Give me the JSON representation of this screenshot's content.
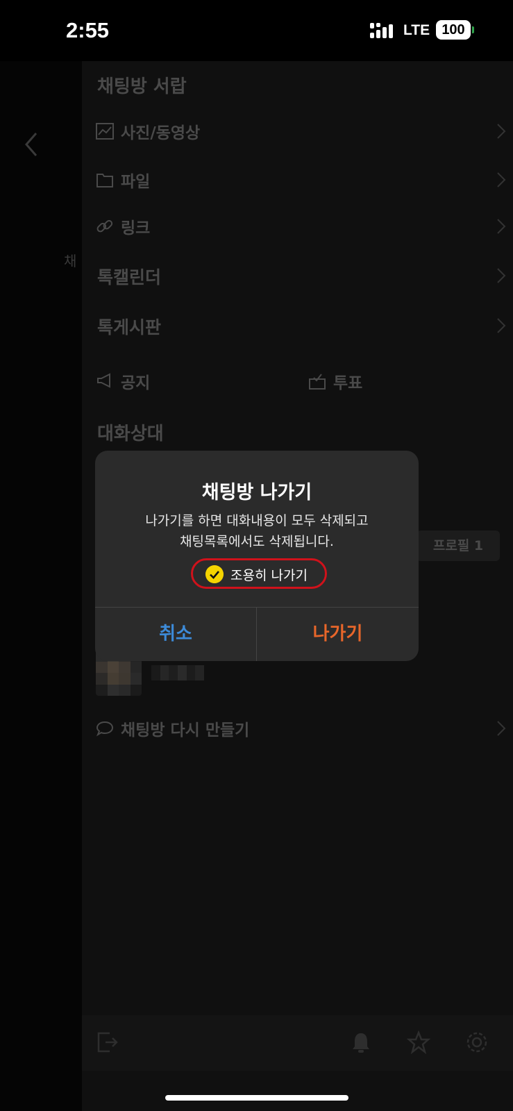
{
  "status_bar": {
    "time": "2:55",
    "network": "LTE",
    "battery": "100"
  },
  "background": {
    "chat_title_peek": "채"
  },
  "drawer": {
    "title": "채팅방 서랍",
    "items": [
      {
        "label": "사진/동영상",
        "icon": "photo-icon"
      },
      {
        "label": "파일",
        "icon": "folder-icon"
      },
      {
        "label": "링크",
        "icon": "link-icon"
      },
      {
        "label": "톡캘린더"
      },
      {
        "label": "톡게시판"
      }
    ],
    "notice_label": "공지",
    "vote_label": "투표",
    "members_title": "대화상대",
    "profile_chip": "프로필 1",
    "recreate_label": "채팅방 다시 만들기"
  },
  "dialog": {
    "title": "채팅방 나가기",
    "message_line1": "나가기를 하면 대화내용이 모두 삭제되고",
    "message_line2": "채팅목록에서도 삭제됩니다.",
    "quiet_leave_label": "조용히 나가기",
    "quiet_leave_checked": true,
    "cancel_label": "취소",
    "leave_label": "나가기",
    "colors": {
      "cancel": "#3d8bd9",
      "leave": "#e8662a",
      "check": "#f5d400",
      "highlight": "#d0121b"
    }
  }
}
